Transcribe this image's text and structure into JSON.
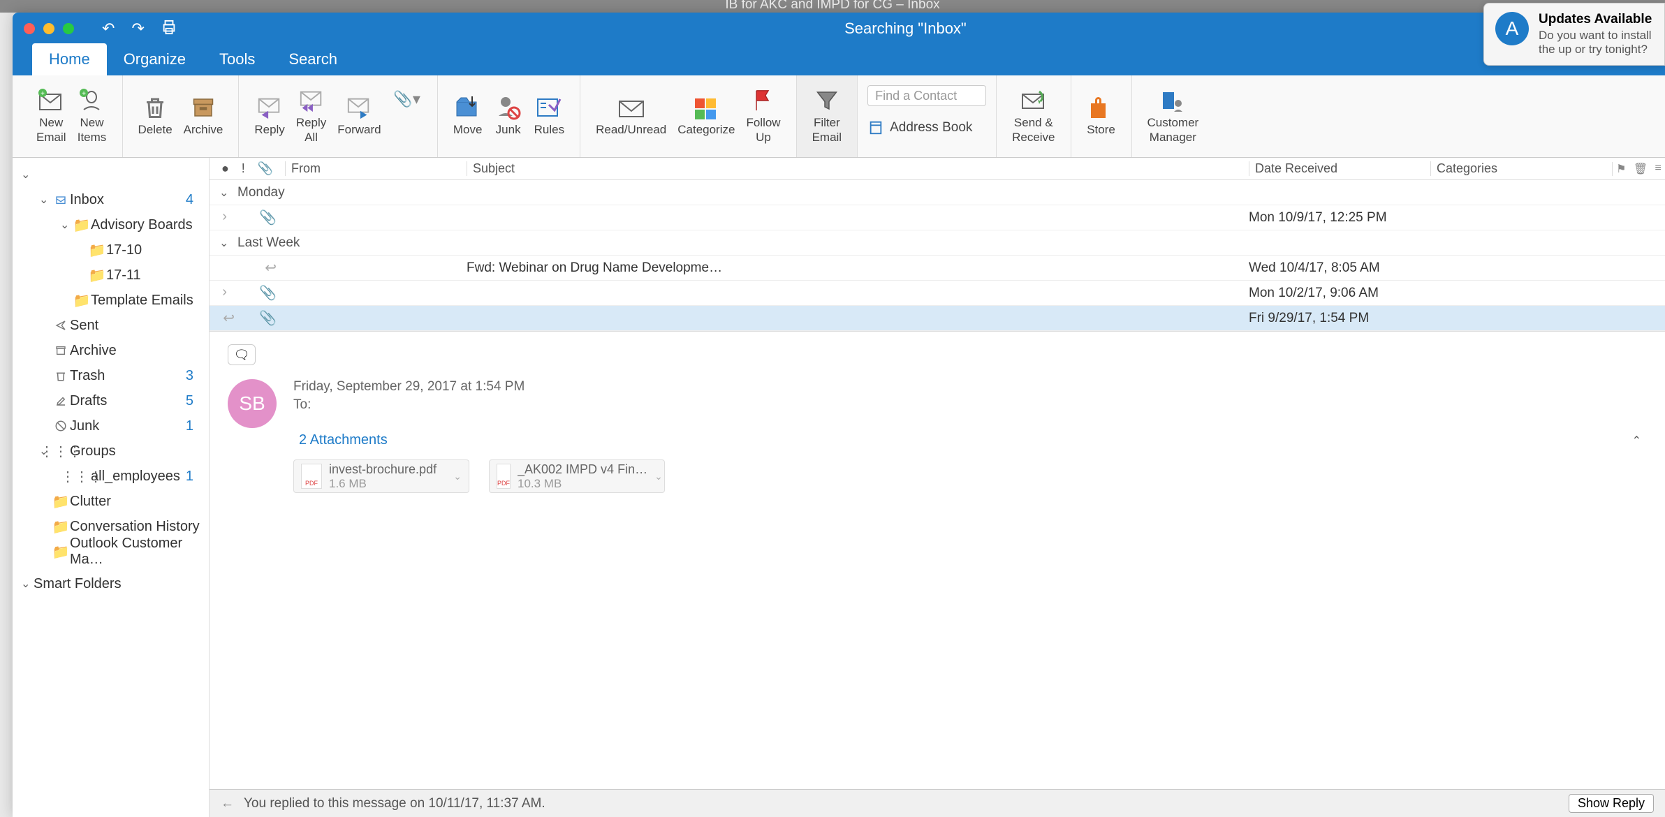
{
  "background_title": "IB for AKC and IMPD for CG – Inbox",
  "window": {
    "title": "Searching \"Inbox\""
  },
  "tabs": [
    "Home",
    "Organize",
    "Tools",
    "Search"
  ],
  "active_tab": "Home",
  "ribbon": {
    "new_email": "New\nEmail",
    "new_items": "New\nItems",
    "delete": "Delete",
    "archive": "Archive",
    "reply": "Reply",
    "reply_all": "Reply\nAll",
    "forward": "Forward",
    "move": "Move",
    "junk": "Junk",
    "rules": "Rules",
    "read_unread": "Read/Unread",
    "categorize": "Categorize",
    "follow_up": "Follow\nUp",
    "filter_email": "Filter\nEmail",
    "find_contact_placeholder": "Find a Contact",
    "address_book": "Address Book",
    "send_receive": "Send &\nReceive",
    "store": "Store",
    "customer_manager": "Customer\nManager"
  },
  "columns": {
    "from": "From",
    "subject": "Subject",
    "date": "Date Received",
    "categories": "Categories"
  },
  "sidebar": {
    "inbox": {
      "label": "Inbox",
      "count": "4"
    },
    "advisory": "Advisory Boards",
    "f1710": "17-10",
    "f1711": "17-11",
    "templates": "Template Emails",
    "sent": "Sent",
    "archive": "Archive",
    "trash": {
      "label": "Trash",
      "count": "3"
    },
    "drafts": {
      "label": "Drafts",
      "count": "5"
    },
    "junk": {
      "label": "Junk",
      "count": "1"
    },
    "groups": "Groups",
    "all_emp": {
      "label": "all_employees",
      "count": "1"
    },
    "clutter": "Clutter",
    "conv_history": "Conversation History",
    "ocm": "Outlook Customer Ma…",
    "smart": "Smart Folders"
  },
  "groups": {
    "monday": "Monday",
    "last_week": "Last Week"
  },
  "emails": [
    {
      "date": "Mon 10/9/17, 12:25 PM"
    },
    {
      "subject": "Fwd: Webinar on Drug Name Developme…",
      "date": "Wed 10/4/17, 8:05 AM"
    },
    {
      "date": "Mon 10/2/17, 9:06 AM"
    },
    {
      "date": "Fri 9/29/17, 1:54 PM"
    }
  ],
  "reading": {
    "avatar": "SB",
    "date": "Friday, September 29, 2017 at 1:54 PM",
    "to_label": "To:",
    "attachments_label": "2 Attachments",
    "attachments": [
      {
        "name": "invest-brochure.pdf",
        "size": "1.6 MB"
      },
      {
        "name": "_AK002 IMPD v4 Fin…",
        "size": "10.3 MB"
      }
    ],
    "reply_note": "You replied to this message on 10/11/17, 11:37 AM.",
    "show_reply": "Show Reply"
  },
  "notification": {
    "title": "Updates Available",
    "body": "Do you want to install the up or try tonight?"
  }
}
